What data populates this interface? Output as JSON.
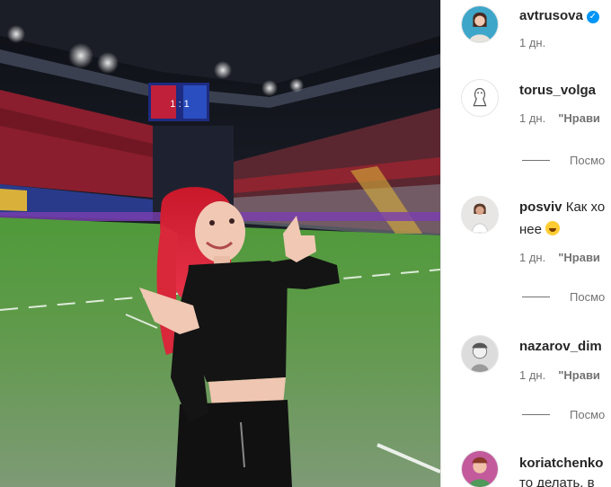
{
  "post": {
    "media_alt_icon": "stadium-photo",
    "scoreboard_text": "1 : 1"
  },
  "comments": [
    {
      "username": "avtrusova",
      "verified": true,
      "text": "",
      "text_line2": "",
      "time": "1 дн.",
      "like": "",
      "replies": ""
    },
    {
      "username": "torus_volga",
      "verified": false,
      "text": "",
      "text_line2": "",
      "time": "1 дн.",
      "like": "\"Нрави",
      "replies": "Посмо"
    },
    {
      "username": "posviv",
      "verified": false,
      "text": "Как хо",
      "text_line2": "нее",
      "time": "1 дн.",
      "like": "\"Нрави",
      "replies": "Посмо"
    },
    {
      "username": "nazarov_dim",
      "verified": false,
      "text": "",
      "text_line2": "",
      "time": "1 дн.",
      "like": "\"Нрави",
      "replies": "Посмо"
    },
    {
      "username": "koriatchenko",
      "verified": false,
      "text": "",
      "text_line2": "то делать, в",
      "time": "",
      "like": "",
      "replies": ""
    }
  ],
  "colors": {
    "accent": "#0095f6",
    "text": "#262626",
    "muted": "#737373"
  }
}
